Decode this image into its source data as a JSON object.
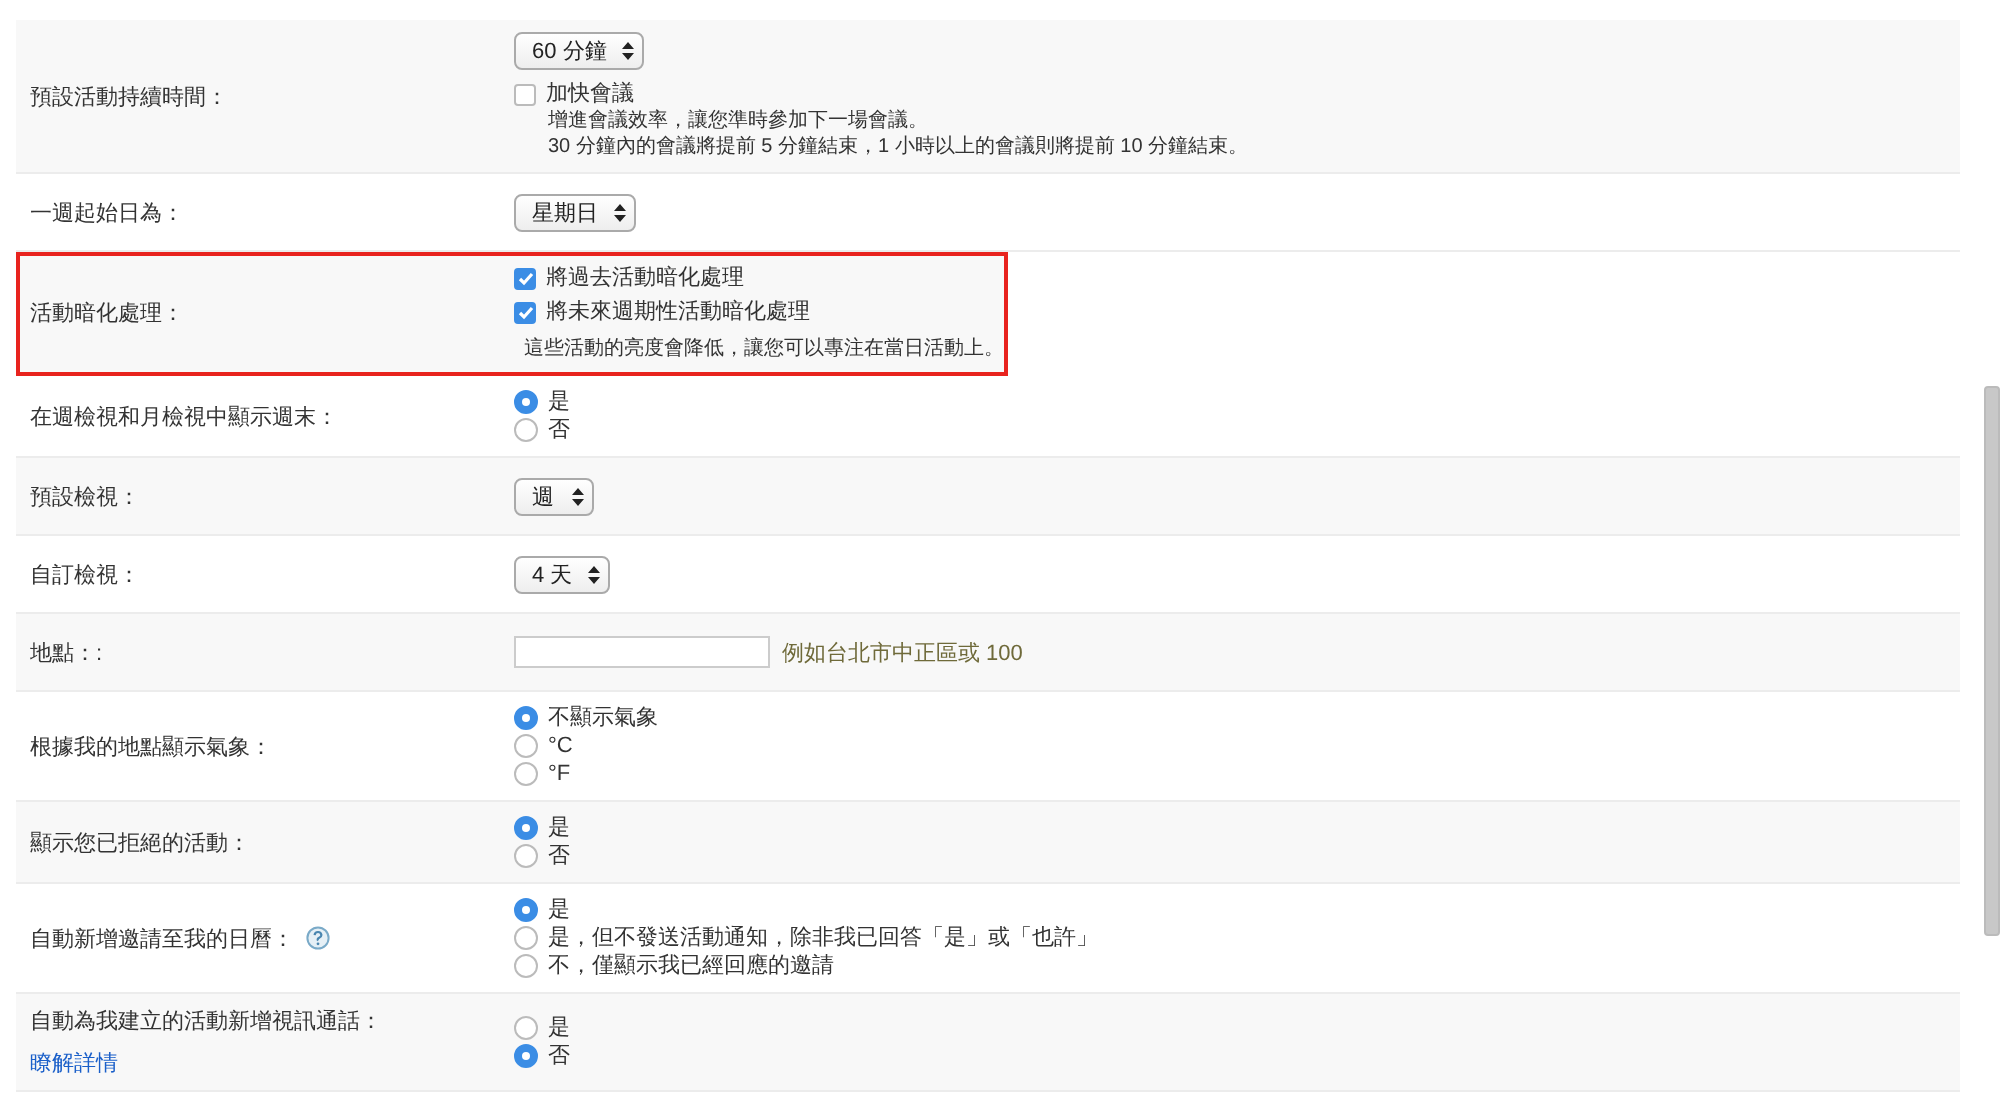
{
  "settings": [
    {
      "kind": "select-checkbox",
      "label": "預設活動持續時間：",
      "highlighted": false,
      "select": "60 分鐘",
      "checkbox": {
        "label": "加快會議",
        "checked": false
      },
      "notes": [
        "增進會議效率，讓您準時參加下一場會議。",
        "30 分鐘內的會議將提前 5 分鐘結束，1 小時以上的會議則將提前 10 分鐘結束。"
      ]
    },
    {
      "kind": "select",
      "label": "一週起始日為：",
      "highlighted": false,
      "select": "星期日"
    },
    {
      "kind": "checkboxes",
      "label": "活動暗化處理：",
      "highlighted": true,
      "checkboxes": [
        {
          "label": "將過去活動暗化處理",
          "checked": true
        },
        {
          "label": "將未來週期性活動暗化處理",
          "checked": true
        }
      ],
      "note": "這些活動的亮度會降低，讓您可以專注在當日活動上。"
    },
    {
      "kind": "radios",
      "label": "在週檢視和月檢視中顯示週末：",
      "highlighted": false,
      "options": [
        {
          "label": "是",
          "selected": true
        },
        {
          "label": "否",
          "selected": false
        }
      ]
    },
    {
      "kind": "select",
      "label": "預設檢視：",
      "highlighted": false,
      "select": "週"
    },
    {
      "kind": "select",
      "label": "自訂檢視：",
      "highlighted": false,
      "select": "4 天"
    },
    {
      "kind": "text",
      "label": "地點：:",
      "highlighted": false,
      "hint": "例如台北市中正區或 100"
    },
    {
      "kind": "radios",
      "label": "根據我的地點顯示氣象：",
      "highlighted": false,
      "options": [
        {
          "label": "不顯示氣象",
          "selected": true
        },
        {
          "label": "°C",
          "selected": false
        },
        {
          "label": "°F",
          "selected": false
        }
      ]
    },
    {
      "kind": "radios",
      "label": "顯示您已拒絕的活動：",
      "highlighted": false,
      "options": [
        {
          "label": "是",
          "selected": true
        },
        {
          "label": "否",
          "selected": false
        }
      ]
    },
    {
      "kind": "radios",
      "label": "自動新增邀請至我的日曆：",
      "help": true,
      "highlighted": false,
      "options": [
        {
          "label": "是",
          "selected": true
        },
        {
          "label": "是，但不發送活動通知，除非我已回答「是」或「也許」",
          "selected": false
        },
        {
          "label": "不，僅顯示我已經回應的邀請",
          "selected": false
        }
      ]
    },
    {
      "kind": "radios",
      "label": "自動為我建立的活動新增視訊通話：",
      "link": "瞭解詳情",
      "highlighted": false,
      "options": [
        {
          "label": "是",
          "selected": false
        },
        {
          "label": "否",
          "selected": true
        }
      ]
    }
  ]
}
